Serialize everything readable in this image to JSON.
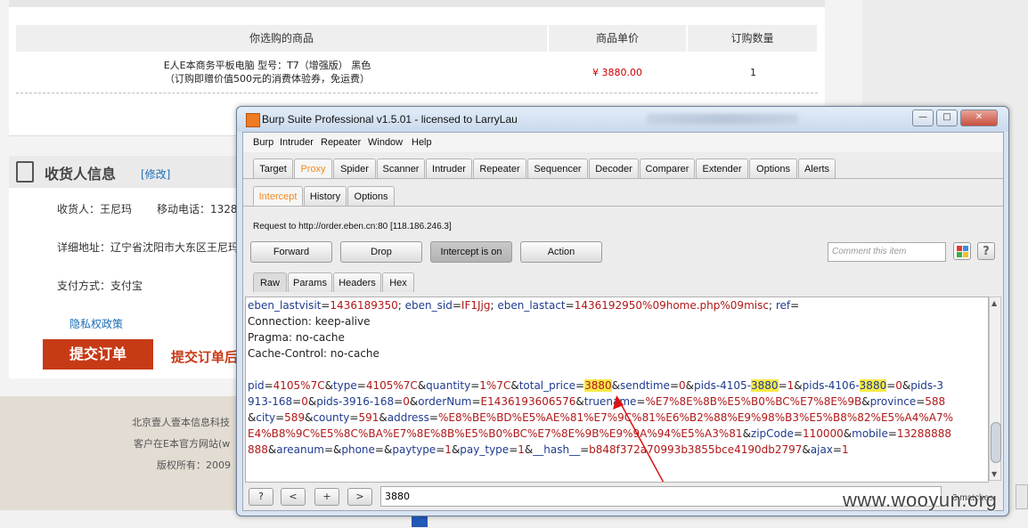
{
  "webpage": {
    "table": {
      "col_product": "你选购的商品",
      "col_price": "商品单价",
      "col_qty": "订购数量",
      "product_line1": "E人E本商务平板电脑 型号：T7（增强版） 黑色",
      "product_line2": "（订购即赠价值500元的消费体验券，免运费）",
      "price": "¥ 3880.00",
      "qty": "1"
    },
    "receiver": {
      "title": "收货人信息",
      "edit_link": "[修改]",
      "name": "收货人：王尼玛",
      "phone": "移动电话：13288",
      "address": "详细地址：辽宁省沈阳市大东区王尼玛",
      "payment": "支付方式：支付宝",
      "privacy": "隐私权政策",
      "submit": "提交订单",
      "submit_note": "提交订单后"
    },
    "footer": {
      "line1": "北京壹人壹本信息科技",
      "line2": "客户在E本官方网站(w",
      "line3": "版权所有：2009"
    }
  },
  "burp": {
    "title": "Burp Suite Professional v1.5.01 - licensed to LarryLau",
    "window_buttons": {
      "minimize": "—",
      "maximize": "□",
      "close": "✕"
    },
    "menu": [
      "Burp",
      "Intruder",
      "Repeater",
      "Window",
      "Help"
    ],
    "tabs": [
      "Target",
      "Proxy",
      "Spider",
      "Scanner",
      "Intruder",
      "Repeater",
      "Sequencer",
      "Decoder",
      "Comparer",
      "Extender",
      "Options",
      "Alerts"
    ],
    "subtabs": [
      "Intercept",
      "History",
      "Options"
    ],
    "request_label": "Request to http://order.eben.cn:80  [118.186.246.3]",
    "buttons": {
      "forward": "Forward",
      "drop": "Drop",
      "intercept": "Intercept is on",
      "action": "Action"
    },
    "comment_placeholder": "Comment this item",
    "view_tabs": [
      "Raw",
      "Params",
      "Headers",
      "Hex"
    ],
    "search": {
      "prev": "<",
      "add": "+",
      "next": ">",
      "help": "?",
      "value": "3880",
      "matches": "3 matches"
    }
  },
  "watermark": "www.wooyun.org",
  "colors": {
    "accent": "#f08a24",
    "highlight": "#f7e948",
    "submit": "#c73a16"
  }
}
